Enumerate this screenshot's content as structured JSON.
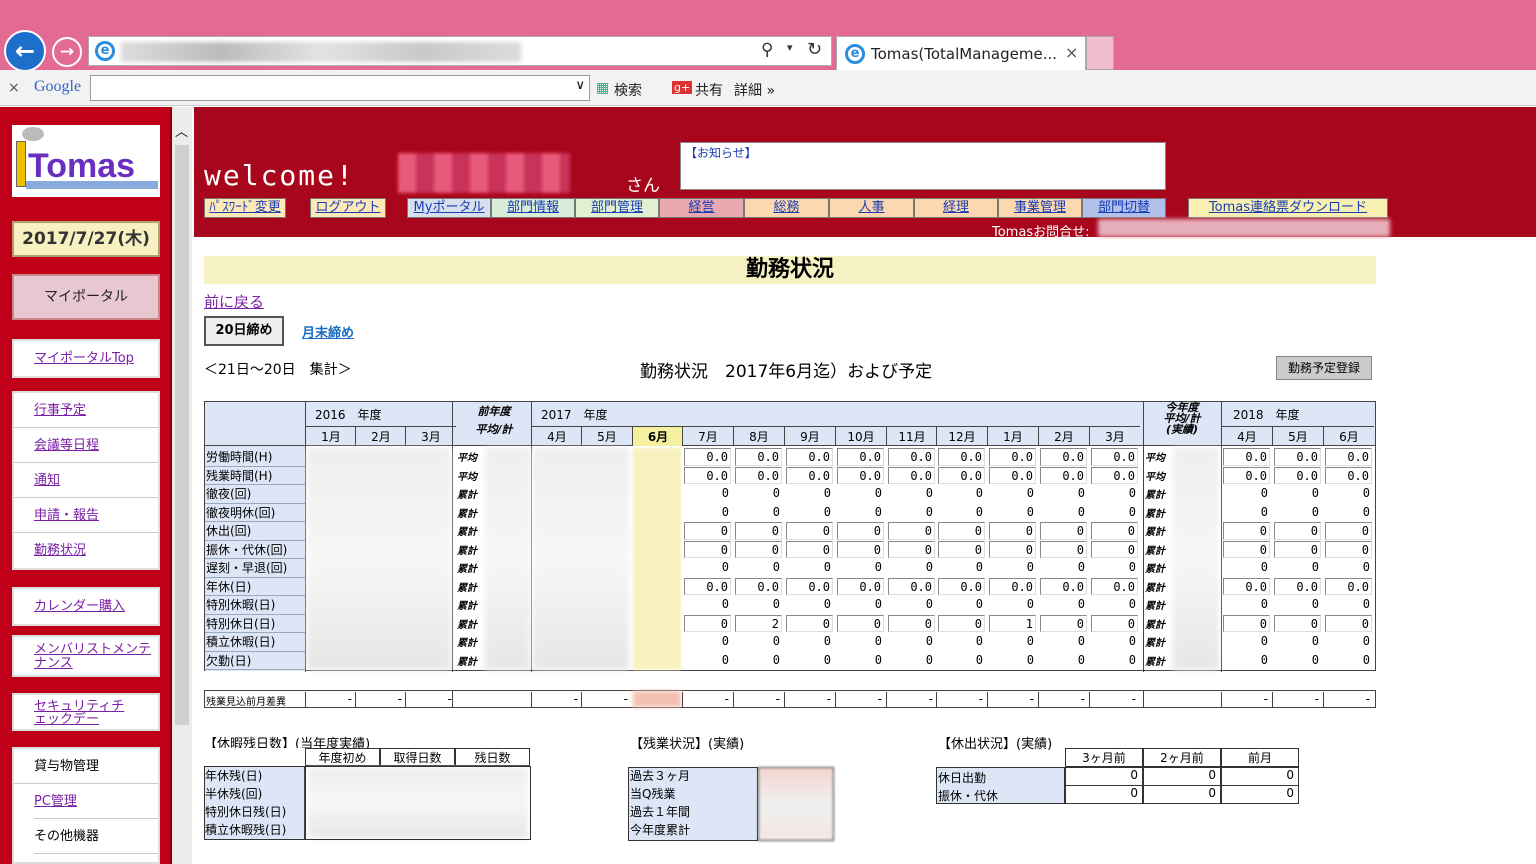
{
  "browser": {
    "tab_title": "Tomas(TotalManageme...",
    "tab_close": "×",
    "google_label": "Google",
    "close_bar": "×",
    "search_label": "検索",
    "share_label": "共有",
    "detail_label": "詳細 »"
  },
  "sidebar": {
    "logo_text": "Tomas",
    "date": "2017/7/27(木)",
    "myportal": "マイポータル",
    "items_top": [
      "マイポータルTop"
    ],
    "items_main": [
      "行事予定",
      "会議等日程",
      "通知",
      "申請・報告",
      "勤務状況"
    ],
    "calendar": "カレンダー購入",
    "member": "メンバリストメンテナンス",
    "security": "セキュリティチェックデー",
    "lend": "貸与物管理",
    "pc": "PC管理",
    "other": "その他機器"
  },
  "header": {
    "welcome": "welcome!",
    "san": "さん",
    "notice": "【お知らせ】",
    "menu": [
      "ﾊﾟｽﾜｰﾄﾞ変更",
      "ログアウト",
      "Myポータル",
      "部門情報",
      "部門管理",
      "経営",
      "総務",
      "人事",
      "経理",
      "事業管理",
      "部門切替",
      "Tomas連絡票ダウンロード"
    ],
    "contact": "Tomasお問合せ:"
  },
  "page": {
    "title": "勤務状況",
    "back": "前に戻る",
    "tab_20": "20日締め",
    "tab_month": "月末締め",
    "range": "＜21日～20日　集計＞",
    "main_title": "勤務状況　2017年6月迄）および予定",
    "register_btn": "勤務予定登録"
  },
  "table": {
    "year2016": "2016　年度",
    "prev_avg": "前年度\n平均/計",
    "year2017": "2017　年度",
    "this_avg": "今年度\n平均/計\n(実績)",
    "year2018": "2018　年度",
    "months_2016": [
      "1月",
      "2月",
      "3月"
    ],
    "months_2017": [
      "4月",
      "5月",
      "6月",
      "7月",
      "8月",
      "9月",
      "10月",
      "11月",
      "12月",
      "1月",
      "2月",
      "3月"
    ],
    "months_2018": [
      "4月",
      "5月",
      "6月"
    ],
    "rows": [
      {
        "label": "労働時間(H)",
        "kind": "平均",
        "vals": [
          "0.0",
          "0.0",
          "0.0",
          "0.0",
          "0.0",
          "0.0",
          "0.0",
          "0.0",
          "0.0"
        ],
        "next": [
          "0.0",
          "0.0",
          "0.0"
        ]
      },
      {
        "label": "残業時間(H)",
        "kind": "平均",
        "vals": [
          "0.0",
          "0.0",
          "0.0",
          "0.0",
          "0.0",
          "0.0",
          "0.0",
          "0.0",
          "0.0"
        ],
        "next": [
          "0.0",
          "0.0",
          "0.0"
        ]
      },
      {
        "label": "徹夜(回)",
        "kind": "累計",
        "vals": [
          "0",
          "0",
          "0",
          "0",
          "0",
          "0",
          "0",
          "0",
          "0"
        ],
        "next": [
          "0",
          "0",
          "0"
        ]
      },
      {
        "label": "徹夜明休(回)",
        "kind": "累計",
        "vals": [
          "0",
          "0",
          "0",
          "0",
          "0",
          "0",
          "0",
          "0",
          "0"
        ],
        "next": [
          "0",
          "0",
          "0"
        ]
      },
      {
        "label": "休出(回)",
        "kind": "累計",
        "vals": [
          "0",
          "0",
          "0",
          "0",
          "0",
          "0",
          "0",
          "0",
          "0"
        ],
        "next": [
          "0",
          "0",
          "0"
        ]
      },
      {
        "label": "振休・代休(回)",
        "kind": "累計",
        "vals": [
          "0",
          "0",
          "0",
          "0",
          "0",
          "0",
          "0",
          "0",
          "0"
        ],
        "next": [
          "0",
          "0",
          "0"
        ]
      },
      {
        "label": "遅刻・早退(回)",
        "kind": "累計",
        "vals": [
          "0",
          "0",
          "0",
          "0",
          "0",
          "0",
          "0",
          "0",
          "0"
        ],
        "next": [
          "0",
          "0",
          "0"
        ]
      },
      {
        "label": "年休(日)",
        "kind": "累計",
        "vals": [
          "0.0",
          "0.0",
          "0.0",
          "0.0",
          "0.0",
          "0.0",
          "0.0",
          "0.0",
          "0.0"
        ],
        "next": [
          "0.0",
          "0.0",
          "0.0"
        ]
      },
      {
        "label": "特別休暇(日)",
        "kind": "累計",
        "vals": [
          "0",
          "0",
          "0",
          "0",
          "0",
          "0",
          "0",
          "0",
          "0"
        ],
        "next": [
          "0",
          "0",
          "0"
        ]
      },
      {
        "label": "特別休日(日)",
        "kind": "累計",
        "vals": [
          "0",
          "2",
          "0",
          "0",
          "0",
          "0",
          "1",
          "0",
          "0"
        ],
        "next": [
          "0",
          "0",
          "0"
        ]
      },
      {
        "label": "積立休暇(日)",
        "kind": "累計",
        "vals": [
          "0",
          "0",
          "0",
          "0",
          "0",
          "0",
          "0",
          "0",
          "0"
        ],
        "next": [
          "0",
          "0",
          "0"
        ]
      },
      {
        "label": "欠勤(日)",
        "kind": "累計",
        "vals": [
          "0",
          "0",
          "0",
          "0",
          "0",
          "0",
          "0",
          "0",
          "0"
        ],
        "next": [
          "0",
          "0",
          "0"
        ]
      }
    ],
    "diff_label": "残業見込前月差異",
    "dash": "-"
  },
  "leave": {
    "title": "【休暇残日数】(当年度実績)",
    "cols": [
      "年度初め",
      "取得日数",
      "残日数"
    ],
    "rows": [
      "年休残(日)",
      "半休残(回)",
      "特別休日残(日)",
      "積立休暇残(日)"
    ]
  },
  "overtime": {
    "title": "【残業状況】(実績)",
    "rows": [
      "過去３ヶ月",
      "当Q残業",
      "過去１年間",
      "今年度累計"
    ]
  },
  "holiday": {
    "title": "【休出状況】(実績)",
    "cols": [
      "3ヶ月前",
      "2ヶ月前",
      "前月"
    ],
    "rows": [
      {
        "label": "休日出勤",
        "vals": [
          "0",
          "0",
          "0"
        ]
      },
      {
        "label": "振休・代休",
        "vals": [
          "0",
          "0",
          "0"
        ]
      }
    ]
  }
}
